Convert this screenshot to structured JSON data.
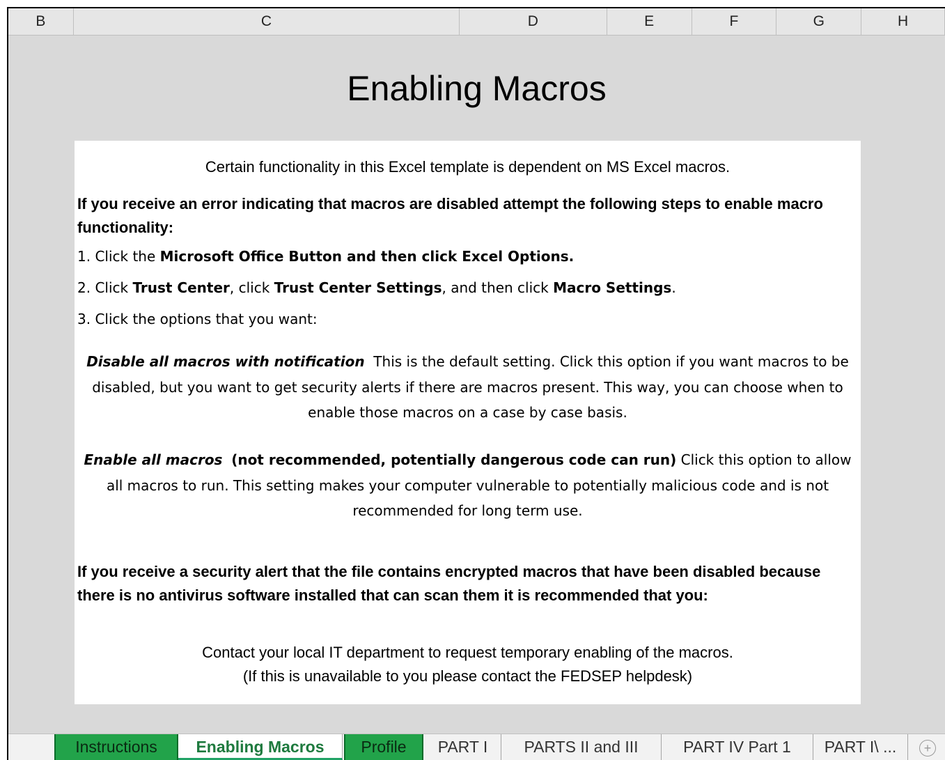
{
  "columns": [
    "B",
    "C",
    "D",
    "E",
    "F",
    "G",
    "H"
  ],
  "title": "Enabling Macros",
  "intro": "Certain functionality in this Excel template is dependent on MS Excel macros.",
  "heading1": "If you receive an error indicating that macros are disabled attempt the following steps to enable macro functionality:",
  "step1": {
    "prefix": "1. Click the ",
    "bold": "Microsoft Office Button and then click Excel Options."
  },
  "step2": {
    "p1": "2. Click ",
    "b1": "Trust Center",
    "p2": ", click ",
    "b2": "Trust Center Settings",
    "p3": ", and then click ",
    "b3": "Macro Settings",
    "p4": "."
  },
  "step3": "3. Click the options that you want:",
  "option1": {
    "name": "Disable all macros with notification",
    "text": "This is the default setting. Click this option if you want macros to be disabled, but you want to get security alerts if there are macros present. This way, you can choose when to enable those macros on a case by case basis."
  },
  "option2": {
    "name": "Enable all macros",
    "warning": "(not recommended, potentially dangerous code can run)",
    "text": "Click this option to allow all macros to run. This setting makes your computer vulnerable to potentially malicious code and is not recommended for long term use."
  },
  "heading2": "If you receive  a security alert that the file contains encrypted macros that have been disabled because there is no antivirus software installed that can scan them it is recommended that you:",
  "contact1": "Contact your local IT department to request temporary enabling of the macros.",
  "contact2": "(If this is unavailable to you please contact the FEDSEP helpdesk)",
  "tabs": [
    "Instructions",
    "Enabling Macros",
    "Profile",
    "PART I",
    "PARTS II and III",
    "PART IV Part 1",
    "PART I\\ ..."
  ],
  "add_sheet_icon": "plus-circle-icon"
}
